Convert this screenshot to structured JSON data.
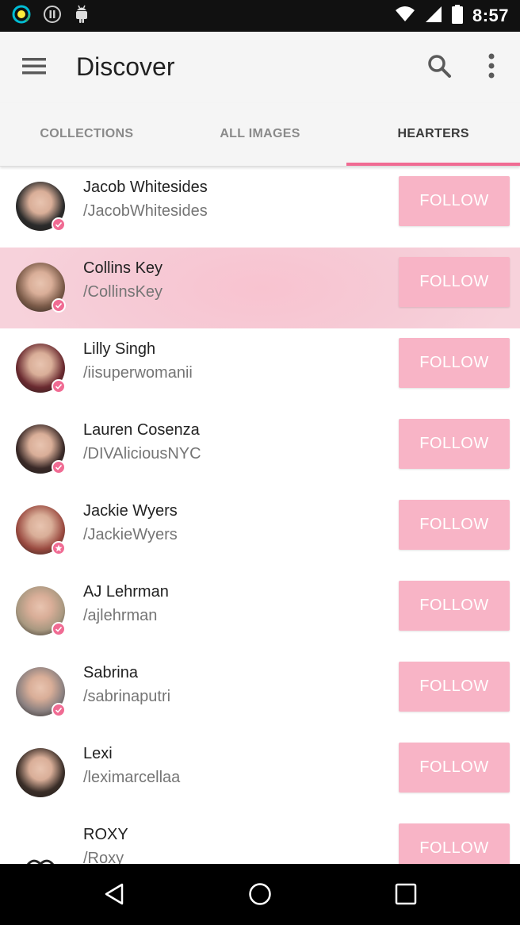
{
  "status_bar": {
    "time": "8:57",
    "icons_left": [
      "circle-app-icon",
      "pause-icon",
      "android-icon"
    ],
    "icons_right": [
      "wifi-icon",
      "signal-icon",
      "battery-icon"
    ]
  },
  "app_bar": {
    "title": "Discover",
    "icons": [
      "menu-icon",
      "search-icon",
      "more-vertical-icon"
    ]
  },
  "tabs": [
    {
      "label": "COLLECTIONS",
      "active": false
    },
    {
      "label": "ALL IMAGES",
      "active": false
    },
    {
      "label": "HEARTERS",
      "active": true
    }
  ],
  "colors": {
    "accent": "#f06b93",
    "follow_button": "#f8b4c6",
    "pressed_row": "#f8c3d0",
    "background": "#f5f5f5"
  },
  "follow_label": "FOLLOW",
  "users": [
    {
      "name": "Jacob Whitesides",
      "handle": "/JacobWhitesides",
      "badge": "check",
      "pressed": false,
      "avatar_tone": "#2b2b2b"
    },
    {
      "name": "Collins Key",
      "handle": "/CollinsKey",
      "badge": "check",
      "pressed": true,
      "avatar_tone": "#7a5a48"
    },
    {
      "name": "Lilly Singh",
      "handle": "/iisuperwomanii",
      "badge": "check",
      "pressed": false,
      "avatar_tone": "#6a2a30"
    },
    {
      "name": "Lauren Cosenza",
      "handle": "/DIVAliciousNYC",
      "badge": "check",
      "pressed": false,
      "avatar_tone": "#3a2a28"
    },
    {
      "name": "Jackie Wyers",
      "handle": "/JackieWyers",
      "badge": "star",
      "pressed": false,
      "avatar_tone": "#9a4a40"
    },
    {
      "name": "AJ Lehrman",
      "handle": "/ajlehrman",
      "badge": "check",
      "pressed": false,
      "avatar_tone": "#a89880"
    },
    {
      "name": "Sabrina",
      "handle": "/sabrinaputri",
      "badge": "check",
      "pressed": false,
      "avatar_tone": "#8a8080"
    },
    {
      "name": "Lexi",
      "handle": "/leximarcellaa",
      "badge": "none",
      "pressed": false,
      "avatar_tone": "#3a2e28"
    },
    {
      "name": "ROXY",
      "handle": "/Roxy",
      "badge": "none",
      "pressed": false,
      "avatar_tone": "#ffffff"
    }
  ],
  "nav_bar": {
    "buttons": [
      "back-icon",
      "home-icon",
      "recents-icon"
    ]
  }
}
